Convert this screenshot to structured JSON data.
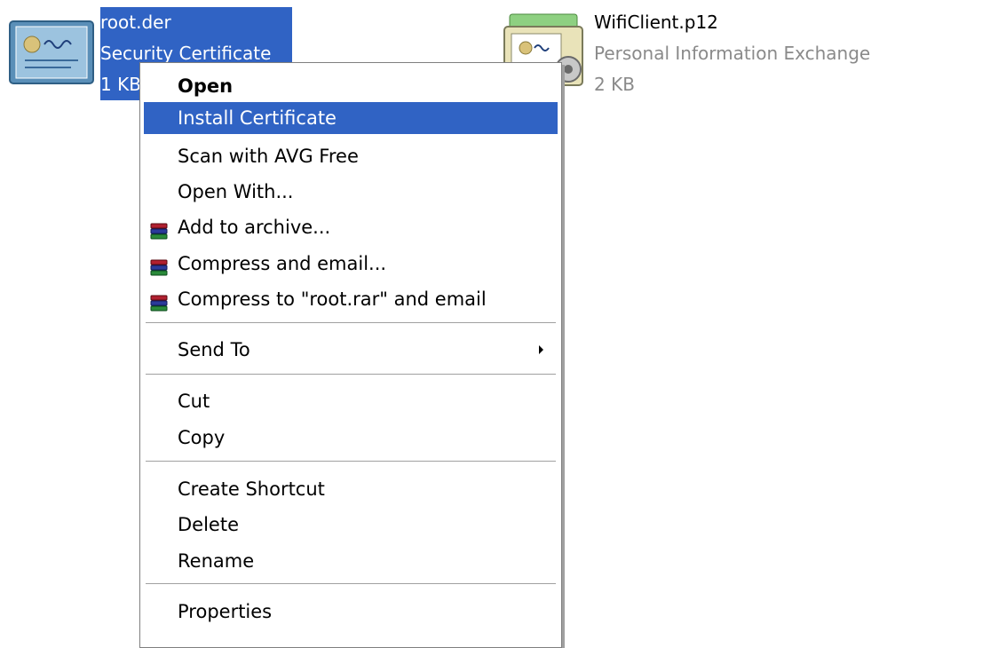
{
  "desktop": {
    "files": [
      {
        "name": "root.der",
        "type": "Security Certificate",
        "size": "1 KB",
        "icon": "certificate-icon",
        "selected": true
      },
      {
        "name": "WifiClient.p12",
        "type": "Personal Information Exchange",
        "size": "2 KB",
        "icon": "pfx-certificate-icon",
        "selected": false
      }
    ]
  },
  "context_menu": {
    "items": [
      {
        "label": "Open",
        "bold": true
      },
      {
        "label": "Install Certificate",
        "highlighted": true
      },
      {
        "label": "Scan with AVG Free"
      },
      {
        "label": "Open With..."
      },
      {
        "label": "Add to archive...",
        "icon": "winrar-icon"
      },
      {
        "label": "Compress and email...",
        "icon": "winrar-icon"
      },
      {
        "label": "Compress to \"root.rar\" and email",
        "icon": "winrar-icon"
      },
      {
        "label": "Send To",
        "submenu": true
      },
      {
        "label": "Cut"
      },
      {
        "label": "Copy"
      },
      {
        "label": "Create Shortcut"
      },
      {
        "label": "Delete"
      },
      {
        "label": "Rename"
      },
      {
        "label": "Properties"
      }
    ]
  },
  "colors": {
    "selection": "#3063c4",
    "secondary_text": "#8a8a8a"
  }
}
